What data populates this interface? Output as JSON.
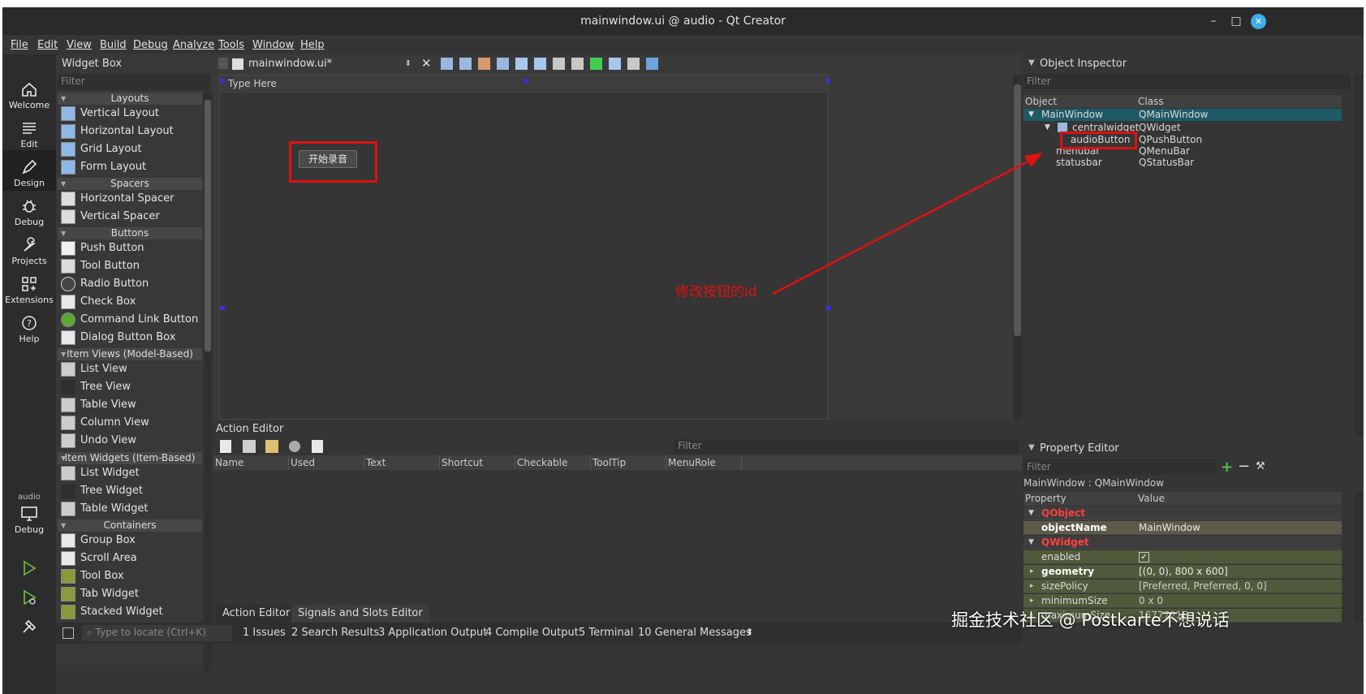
{
  "window": {
    "title": "mainwindow.ui @ audio - Qt Creator",
    "min": "–",
    "max": "□",
    "close": "✕"
  },
  "menubar": [
    "File",
    "Edit",
    "View",
    "Build",
    "Debug",
    "Analyze",
    "Tools",
    "Window",
    "Help"
  ],
  "modes": {
    "welcome": "Welcome",
    "edit": "Edit",
    "design": "Design",
    "debug": "Debug",
    "projects": "Projects",
    "extensions": "Extensions",
    "help": "Help",
    "kit_label": "audio",
    "kit_debug": "Debug"
  },
  "widget_box": {
    "title": "Widget Box",
    "filter": "Filter",
    "categories": {
      "layouts": "Layouts",
      "spacers": "Spacers",
      "buttons": "Buttons",
      "item_views": "Item Views (Model-Based)",
      "item_widgets": "Item Widgets (Item-Based)",
      "containers": "Containers"
    },
    "items": {
      "vertical_layout": "Vertical Layout",
      "horizontal_layout": "Horizontal Layout",
      "grid_layout": "Grid Layout",
      "form_layout": "Form Layout",
      "horizontal_spacer": "Horizontal Spacer",
      "vertical_spacer": "Vertical Spacer",
      "push_button": "Push Button",
      "tool_button": "Tool Button",
      "radio_button": "Radio Button",
      "check_box": "Check Box",
      "command_link_button": "Command Link Button",
      "dialog_button_box": "Dialog Button Box",
      "list_view": "List View",
      "tree_view": "Tree View",
      "table_view": "Table View",
      "column_view": "Column View",
      "undo_view": "Undo View",
      "list_widget": "List Widget",
      "tree_widget": "Tree Widget",
      "table_widget": "Table Widget",
      "group_box": "Group Box",
      "scroll_area": "Scroll Area",
      "tool_box": "Tool Box",
      "tab_widget": "Tab Widget",
      "stacked_widget": "Stacked Widget"
    }
  },
  "editor": {
    "file": "mainwindow.ui*",
    "form_menu_placeholder": "Type Here",
    "button_text": "开始录音"
  },
  "action_editor": {
    "title": "Action Editor",
    "filter": "Filter",
    "columns": [
      "Name",
      "Used",
      "Text",
      "Shortcut",
      "Checkable",
      "ToolTip",
      "MenuRole"
    ],
    "tabs": {
      "action": "Action Editor",
      "signals": "Signals and Slots Editor"
    }
  },
  "statusbar": {
    "locate": "Type to locate (Ctrl+K)",
    "items": [
      "1  Issues",
      "2  Search Results",
      "3  Application Output",
      "4  Compile Output",
      "5  Terminal",
      "10  General Messages"
    ]
  },
  "object_inspector": {
    "title": "Object Inspector",
    "filter": "Filter",
    "col_object": "Object",
    "col_class": "Class",
    "rows": [
      {
        "object": "MainWindow",
        "class": "QMainWindow"
      },
      {
        "object": "centralwidget",
        "class": "QWidget"
      },
      {
        "object": "audioButton",
        "class": "QPushButton"
      },
      {
        "object": "menubar",
        "class": "QMenuBar"
      },
      {
        "object": "statusbar",
        "class": "QStatusBar"
      }
    ]
  },
  "property_editor": {
    "title": "Property Editor",
    "filter": "Filter",
    "class_line": "MainWindow : QMainWindow",
    "col_property": "Property",
    "col_value": "Value",
    "rows": {
      "qobject": "QObject",
      "objectname": "objectName",
      "objectname_val": "MainWindow",
      "qwidget": "QWidget",
      "enabled": "enabled",
      "enabled_val": "✓",
      "geometry": "geometry",
      "geometry_val": "[(0, 0), 800 x 600]",
      "sizepolicy": "sizePolicy",
      "sizepolicy_val": "[Preferred, Preferred, 0, 0]",
      "minimumsize": "minimumSize",
      "minimumsize_val": "0 x 0",
      "maximumsize": "maximumSize",
      "maximumsize_val": "16777215"
    }
  },
  "annotation": "修改按钮的id",
  "watermark": "掘金技术社区 @ Postkarte不想说话",
  "colors": {
    "accent": "#3daee9",
    "annotation_red": "#e01010",
    "selection": "#1e5b67"
  }
}
